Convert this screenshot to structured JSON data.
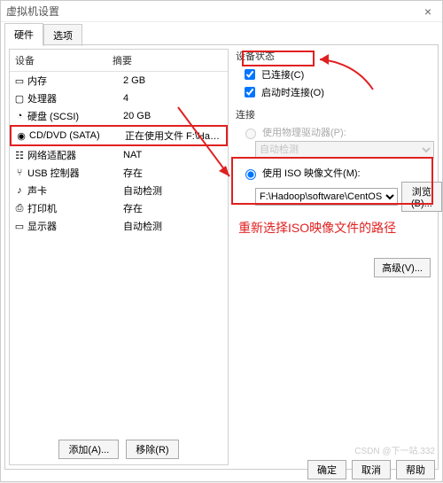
{
  "titlebar": {
    "title": "虚拟机设置"
  },
  "tabs": {
    "hardware": "硬件",
    "options": "选项"
  },
  "list": {
    "head_device": "设备",
    "head_summary": "摘要",
    "rows": [
      {
        "dev": "内存",
        "desc": "2 GB",
        "icon": "memory-icon"
      },
      {
        "dev": "处理器",
        "desc": "4",
        "icon": "cpu-icon"
      },
      {
        "dev": "硬盘 (SCSI)",
        "desc": "20 GB",
        "icon": "disk-icon"
      },
      {
        "dev": "CD/DVD (SATA)",
        "desc": "正在使用文件 F:\\Hadoop\\softw...",
        "icon": "cd-icon",
        "selected": true
      },
      {
        "dev": "网络适配器",
        "desc": "NAT",
        "icon": "net-icon"
      },
      {
        "dev": "USB 控制器",
        "desc": "存在",
        "icon": "usb-icon"
      },
      {
        "dev": "声卡",
        "desc": "自动检测",
        "icon": "sound-icon"
      },
      {
        "dev": "打印机",
        "desc": "存在",
        "icon": "printer-icon"
      },
      {
        "dev": "显示器",
        "desc": "自动检测",
        "icon": "display-icon"
      }
    ]
  },
  "buttons": {
    "add": "添加(A)...",
    "remove": "移除(R)"
  },
  "status": {
    "title": "设备状态",
    "connected": "已连接(C)",
    "connect_on": "启动时连接(O)"
  },
  "connection": {
    "title": "连接",
    "use_physical": "使用物理驱动器(P):",
    "auto_detect": "自动检测",
    "use_iso": "使用 ISO 映像文件(M):",
    "iso_path": "F:\\Hadoop\\software\\CentOS",
    "browse": "浏览(B)..."
  },
  "advanced": "高级(V)...",
  "annotation": "重新选择ISO映像文件的路径",
  "footer": {
    "ok": "确定",
    "cancel": "取消",
    "help": "帮助"
  },
  "watermark": "CSDN @下一站.332"
}
